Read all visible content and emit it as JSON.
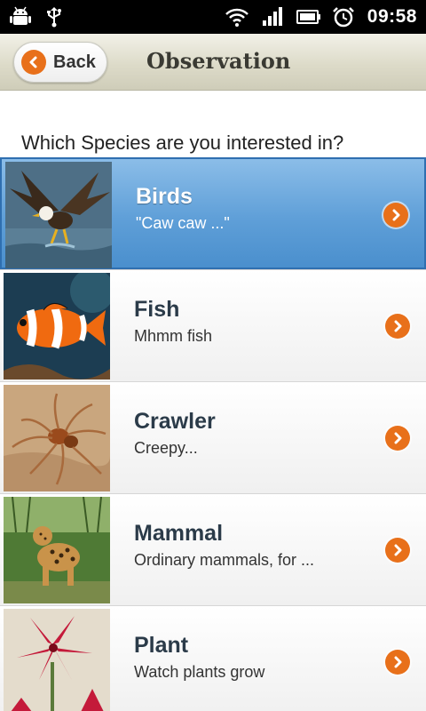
{
  "status_bar": {
    "time": "09:58",
    "icons": [
      "android-icon",
      "usb-icon",
      "wifi-icon",
      "signal-icon",
      "battery-icon",
      "alarm-icon"
    ]
  },
  "header": {
    "back_label": "Back",
    "title": "Observation"
  },
  "question": "Which Species are you interested in?",
  "species": [
    {
      "title": "Birds",
      "subtitle": "\"Caw caw ...\"",
      "active": true
    },
    {
      "title": "Fish",
      "subtitle": "Mhmm fish",
      "active": false
    },
    {
      "title": "Crawler",
      "subtitle": "Creepy...",
      "active": false
    },
    {
      "title": "Mammal",
      "subtitle": "Ordinary mammals, for ...",
      "active": false
    },
    {
      "title": "Plant",
      "subtitle": "Watch plants grow",
      "active": false
    }
  ],
  "colors": {
    "accent": "#e8701a",
    "active_row": "#5f9fd8",
    "header": "#dddbc9"
  }
}
